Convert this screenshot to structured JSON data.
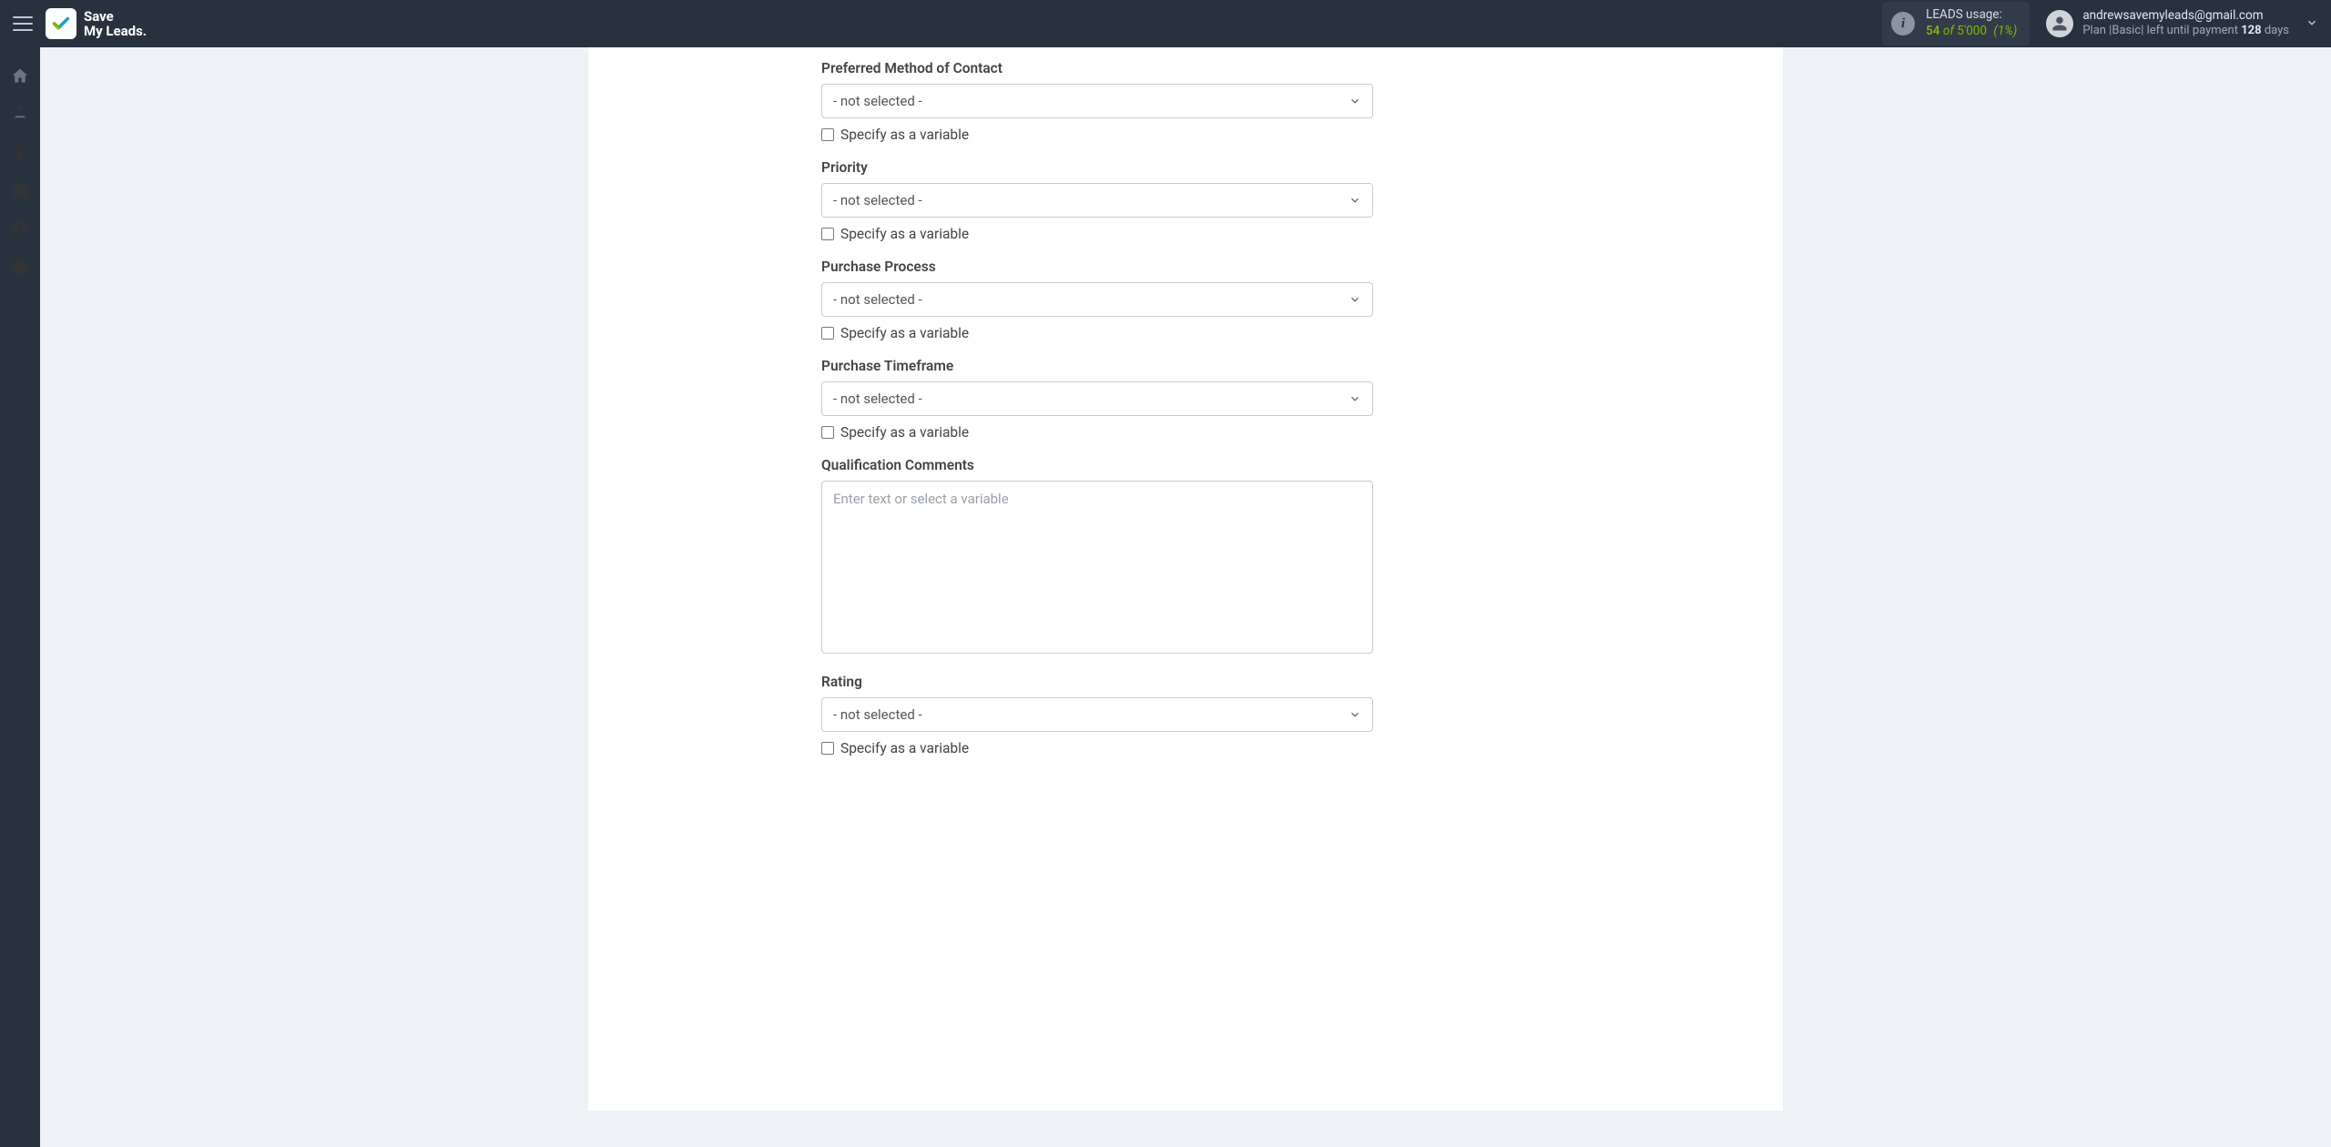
{
  "header": {
    "brand_line1": "Save",
    "brand_line2": "My Leads.",
    "usage": {
      "label": "LEADS usage:",
      "count": "54",
      "of": "of",
      "total": "5'000",
      "pct": "(1%)"
    },
    "user": {
      "email": "andrewsavemyleads@gmail.com",
      "plan_prefix": "Plan |",
      "plan_name": "Basic",
      "plan_suffix": "| left until payment ",
      "days_num": "128",
      "days_word": " days"
    }
  },
  "sidebar": {
    "items": [
      "home",
      "connections",
      "billing",
      "briefcase",
      "account",
      "help"
    ]
  },
  "form": {
    "not_selected": "- not selected -",
    "specify_variable": "Specify as a variable",
    "textarea_placeholder": "Enter text or select a variable",
    "fields": {
      "preferred_contact": {
        "label": "Preferred Method of Contact"
      },
      "priority": {
        "label": "Priority"
      },
      "purchase_process": {
        "label": "Purchase Process"
      },
      "purchase_timeframe": {
        "label": "Purchase Timeframe"
      },
      "qualification_comments": {
        "label": "Qualification Comments"
      },
      "rating": {
        "label": "Rating"
      }
    }
  }
}
